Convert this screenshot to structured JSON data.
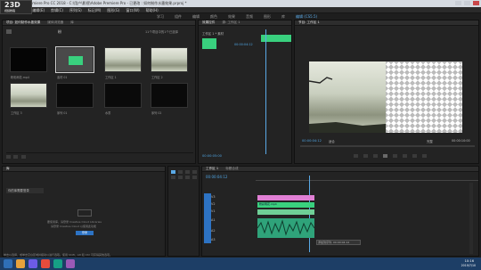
{
  "app": {
    "title": "Adobe Premiere Pro CC 2018 - C:\\用户\\影视\\Adobe Premiere Pro - 已更改 : 如何制作水墨效果.prproj *",
    "menu": [
      "文件(F)",
      "编辑(E)",
      "剪辑(C)",
      "序列(S)",
      "标记(M)",
      "图形(G)",
      "窗口(W)",
      "帮助(H)"
    ],
    "logo_text": "23D",
    "logo_sub": "视频教程"
  },
  "workspaces": [
    "学习",
    "组件",
    "编辑",
    "颜色",
    "效果",
    "音频",
    "图形",
    "库",
    "编辑 (CS5.5)"
  ],
  "active_workspace": "编辑 (CS5.5)",
  "project_panel": {
    "tabs": [
      "项目: 如何制作水墨效果",
      "媒体浏览器",
      "库"
    ],
    "item_count": "11个项目中的1个已选择",
    "bin": "粉",
    "items": [
      {
        "label": "粉彩雨花.mp4",
        "duration": "5:00"
      },
      {
        "label": "素材 01",
        "duration": "5:00"
      },
      {
        "label": "工作区 1",
        "duration": "5:00"
      },
      {
        "label": "工作区 2",
        "duration": "5:00"
      },
      {
        "label": "工作区 3",
        "duration": "5:00"
      },
      {
        "label": "序列 01",
        "duration": "5:00"
      },
      {
        "label": "水墨",
        "duration": "5:00"
      },
      {
        "label": "序列 02",
        "duration": "5:00"
      },
      {
        "label": "合成",
        "duration": "5:00"
      },
      {
        "label": "遮罩素材",
        "duration": "5:00"
      }
    ]
  },
  "effects_panel": {
    "tabs": [
      "效果控件",
      "源: 工作区 1",
      "音频剪辑混合器"
    ],
    "clip_name": "工作区 1 * 素材",
    "timecode": "00:00:04:12",
    "timecode2": "00:00:05:00"
  },
  "program_monitor": {
    "tab": "节目: 工作区 1",
    "timecode": "00:00:04:12",
    "fit": "适合",
    "quality": "完整",
    "duration": "00:00:10:00"
  },
  "library_panel": {
    "tabs": [
      "库"
    ],
    "title": "你的库需要登录",
    "line1": "要使用库，请登录 Creative Cloud Libraries",
    "line2": "请登录 Creative Cloud 以使用此功能",
    "button": "登录"
  },
  "timeline": {
    "tabs": [
      "工作区 1",
      "标题合成"
    ],
    "timecode": "00:00:04:12",
    "tracks": [
      "V3",
      "V2",
      "V1",
      "A1",
      "A2",
      "A3"
    ],
    "clip_label": "粉彩雨花.mp4",
    "tooltip": "添加到序列: 00:00:04:12"
  },
  "status": {
    "hint": "单击以选择，或单击空白区域并拖动以进行选取。使用 Shift、Alt 和 Ctrl 可获得其他选项。",
    "time": "10:16",
    "date": "2019/7/10"
  },
  "colors": {
    "accent": "#5aa9e6",
    "green": "#39d07e",
    "pink": "#e07fd4",
    "audio": "#2fa37a"
  }
}
